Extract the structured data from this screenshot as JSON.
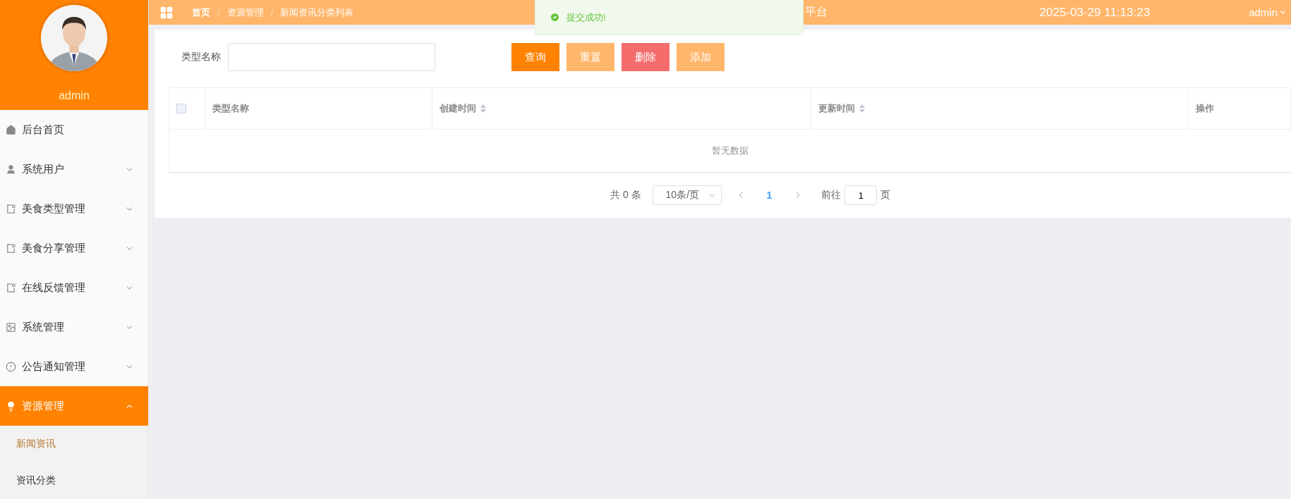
{
  "sidebar": {
    "username": "admin",
    "menu": [
      {
        "label": "后台首页",
        "kind": "link",
        "selected": false
      },
      {
        "label": "系统用户",
        "kind": "submenu",
        "expanded": false,
        "selected": false
      },
      {
        "label": "美食类型管理",
        "kind": "submenu",
        "expanded": false,
        "selected": false
      },
      {
        "label": "美食分享管理",
        "kind": "submenu",
        "expanded": false,
        "selected": false
      },
      {
        "label": "在线反馈管理",
        "kind": "submenu",
        "expanded": false,
        "selected": false
      },
      {
        "label": "系统管理",
        "kind": "submenu",
        "expanded": false,
        "selected": false
      },
      {
        "label": "公告通知管理",
        "kind": "submenu",
        "expanded": false,
        "selected": false
      },
      {
        "label": "资源管理",
        "kind": "submenu",
        "expanded": true,
        "selected": true,
        "children": [
          {
            "label": "新闻资讯",
            "selected": true
          },
          {
            "label": "资讯分类",
            "selected": false
          }
        ]
      }
    ]
  },
  "header": {
    "breadcrumb": [
      "首页",
      "资源管理",
      "新闻资讯分类列表"
    ],
    "breadcrumb_separator": "/",
    "title": "平台",
    "datetime": "2025-03-29 11:13:23",
    "user": "admin"
  },
  "toast": {
    "message": "提交成功!"
  },
  "search": {
    "label": "类型名称"
  },
  "buttons": [
    {
      "label": "查询",
      "color": "#ff8200"
    },
    {
      "label": "重置",
      "color": "#ffb66a"
    },
    {
      "label": "删除",
      "color": "#f56c6c"
    },
    {
      "label": "添加",
      "color": "#ffb66a"
    }
  ],
  "table": {
    "select_all": {
      "checked": false
    },
    "columns": [
      {
        "label": "类型名称",
        "sortable": false
      },
      {
        "label": "创建时间",
        "sortable": true
      },
      {
        "label": "更新时间",
        "sortable": true
      },
      {
        "label": "操作",
        "sortable": false
      }
    ],
    "empty_text": "暂无数据"
  },
  "pagination": {
    "total": "共 0 条",
    "page_size": "10条/页",
    "pages": [
      {
        "label": "1",
        "selected": true
      }
    ],
    "goto_label": "前往",
    "goto_value": "1",
    "goto_suffix": "页"
  }
}
